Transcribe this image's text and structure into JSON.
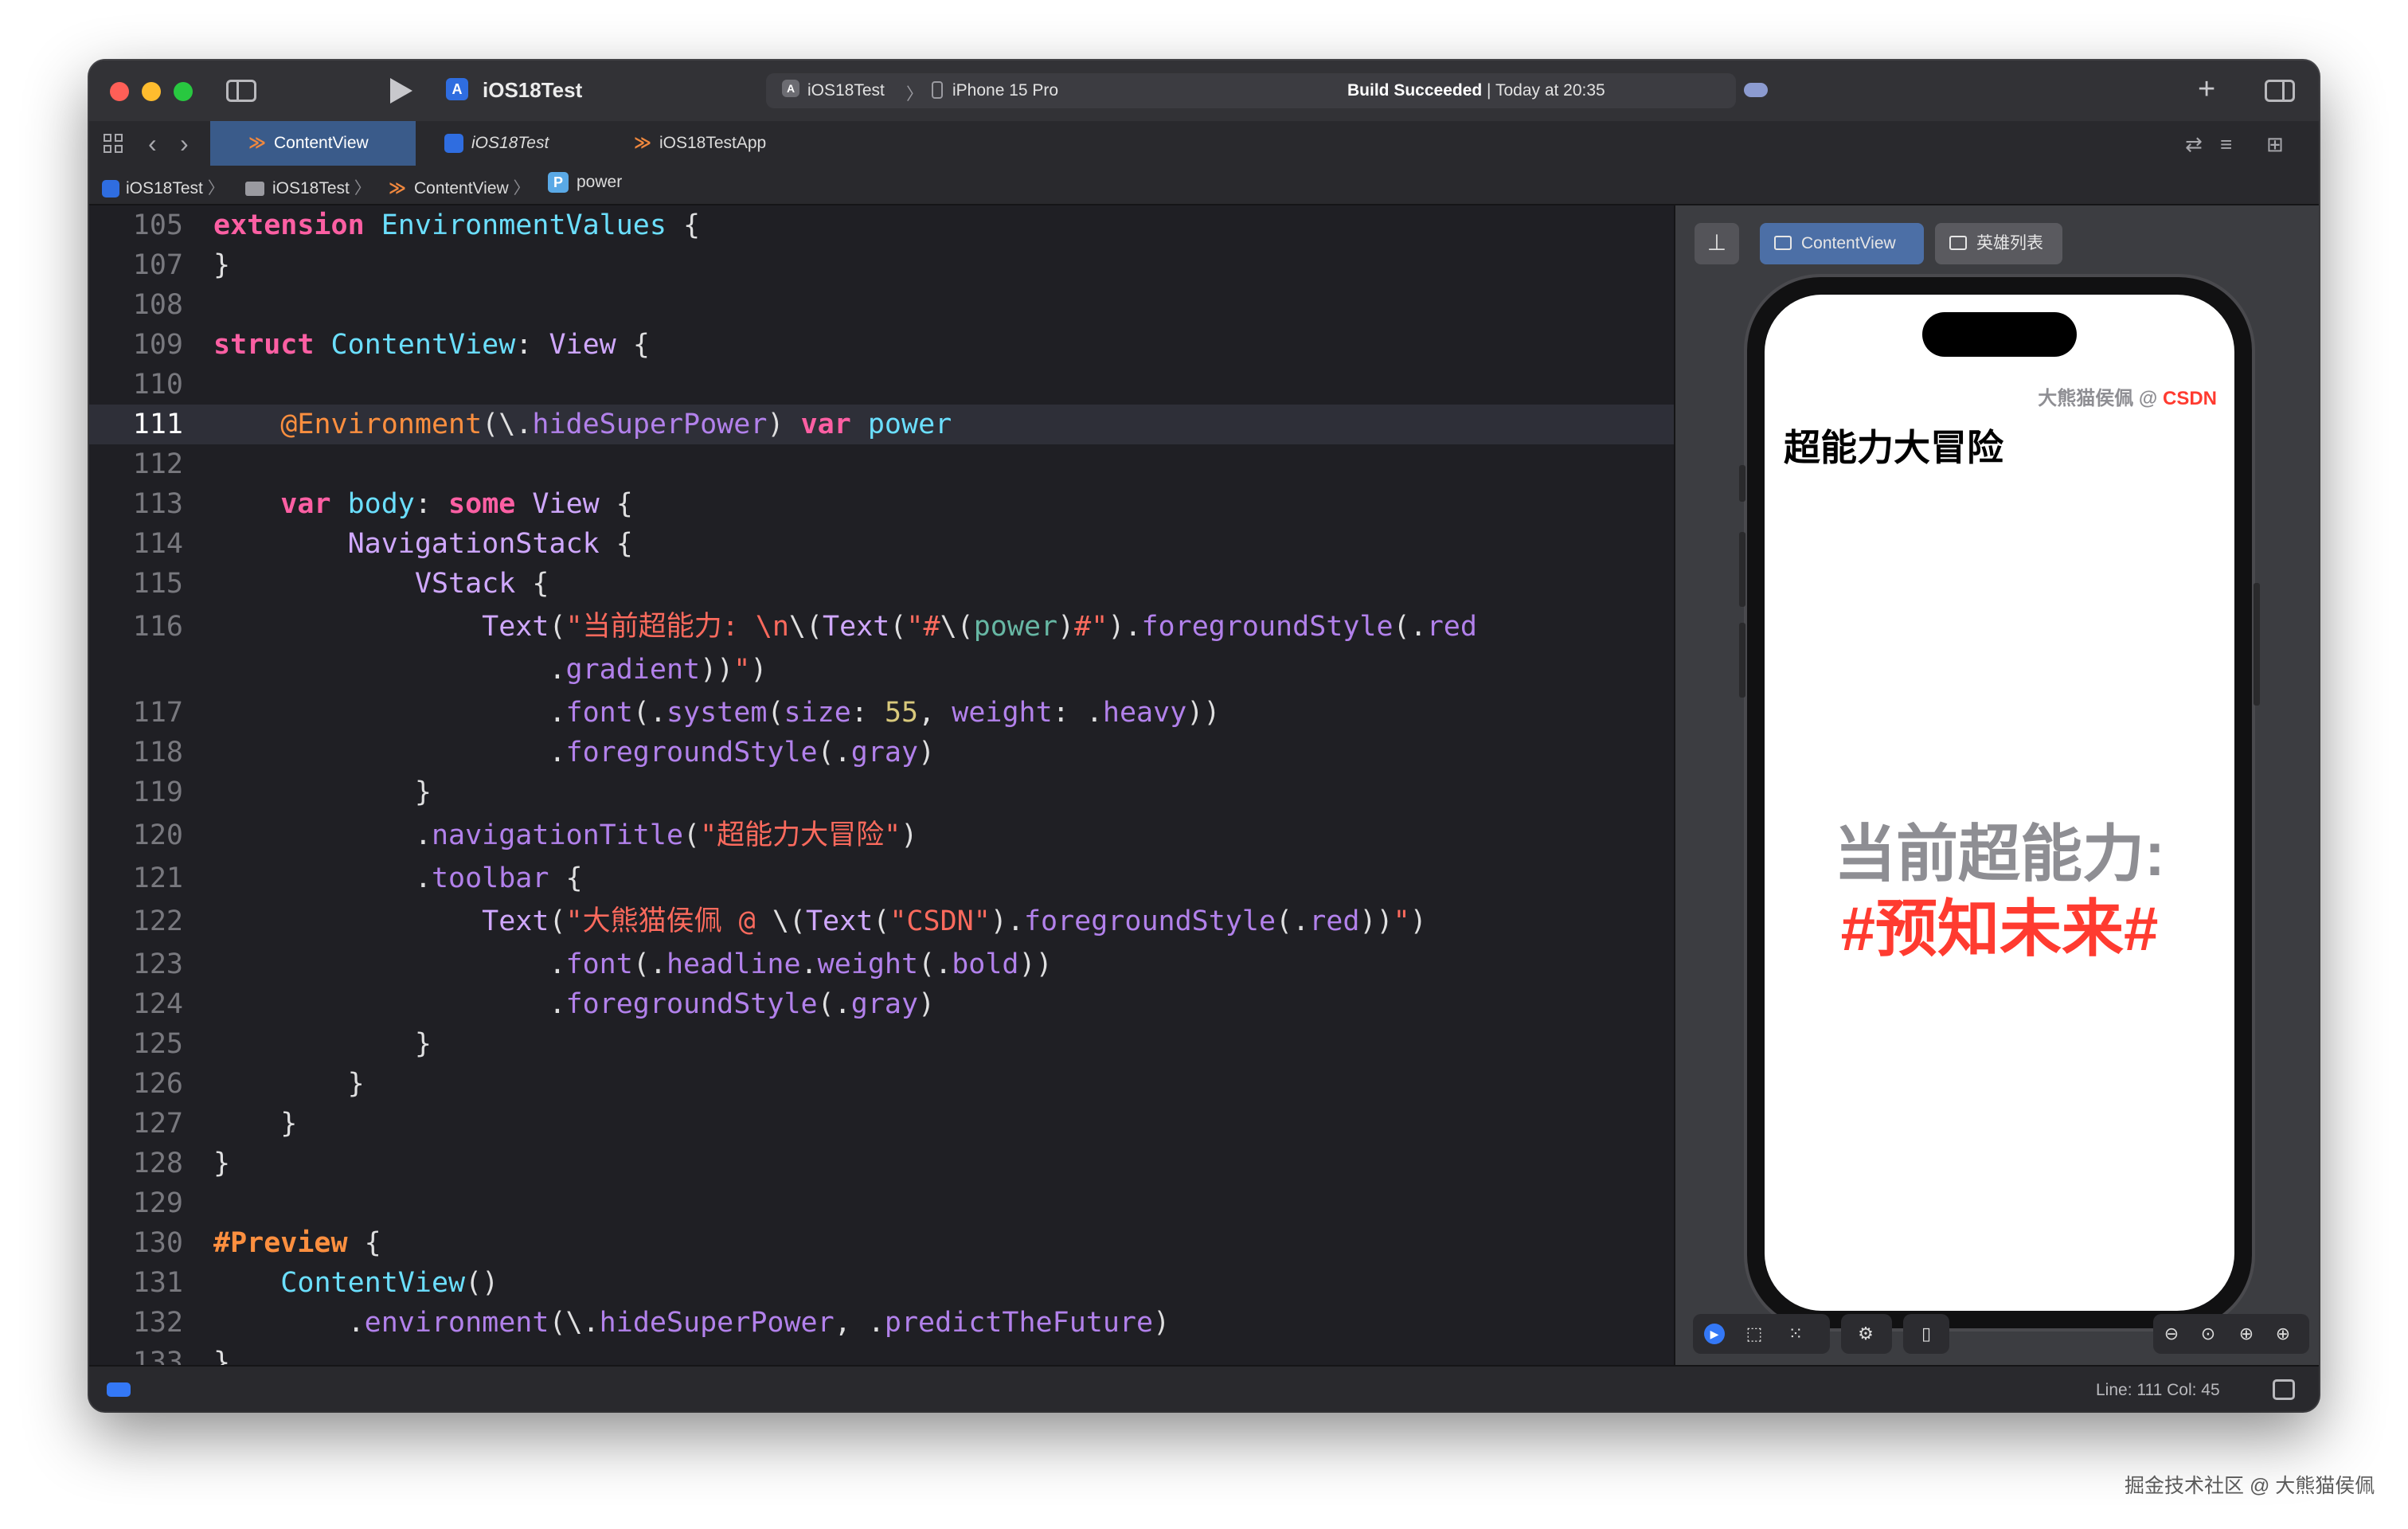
{
  "toolbar": {
    "project_title": "iOS18Test",
    "scheme": "iOS18Test",
    "scheme_chevron": "〉",
    "destination": "iPhone 15 Pro",
    "status_strong": "Build Succeeded",
    "status_rest": " | Today at 20:35"
  },
  "tabs": [
    {
      "label": "ContentView",
      "icon": "swift-icon",
      "active": true
    },
    {
      "label": "iOS18Test",
      "icon": "app-icon",
      "active": false
    },
    {
      "label": "iOS18TestApp",
      "icon": "swift-icon",
      "active": false
    }
  ],
  "jumpbar": [
    "iOS18Test",
    "iOS18Test",
    "ContentView",
    "power"
  ],
  "code_lines": [
    {
      "num": "105",
      "html": "<span class='kw'>extension</span> <span class='ty'>EnvironmentValues</span> {"
    },
    {
      "num": "107",
      "html": "}"
    },
    {
      "num": "108",
      "html": ""
    },
    {
      "num": "109",
      "html": "<span class='kw'>struct</span> <span class='ty'>ContentView</span>: <span class='tyn'>View</span> {"
    },
    {
      "num": "110",
      "html": ""
    },
    {
      "num": "111",
      "html": "    <span class='at'>@Environment</span>(\\.<span class='fn'>hideSuperPower</span>) <span class='kw'>var</span> <span class='ty'>power</span>",
      "current": true
    },
    {
      "num": "112",
      "html": ""
    },
    {
      "num": "113",
      "html": "    <span class='kw'>var</span> <span class='ty'>body</span>: <span class='kw'>some</span> <span class='tyn'>View</span> {"
    },
    {
      "num": "114",
      "html": "        <span class='tyn'>NavigationStack</span> {"
    },
    {
      "num": "115",
      "html": "            <span class='tyn'>VStack</span> {"
    },
    {
      "num": "116",
      "html": "                <span class='tyn'>Text</span>(<span class='st'>\"当前超能力: \\n</span>\\(<span class='tyn'>Text</span>(<span class='st'>\"#</span>\\(<span class='pr'>power</span>)<span class='st'>#\"</span>).<span class='fn'>foregroundStyle</span>(.<span class='fn'>red</span>"
    },
    {
      "num": "",
      "html": "                    .<span class='fn'>gradient</span>))<span class='st'>\"</span>)"
    },
    {
      "num": "117",
      "html": "                    .<span class='fn'>font</span>(.<span class='fn'>system</span>(<span class='fn'>size</span>: <span class='nu'>55</span>, <span class='fn'>weight</span>: .<span class='fn'>heavy</span>))"
    },
    {
      "num": "118",
      "html": "                    .<span class='fn'>foregroundStyle</span>(.<span class='fn'>gray</span>)"
    },
    {
      "num": "119",
      "html": "            }"
    },
    {
      "num": "120",
      "html": "            .<span class='fn'>navigationTitle</span>(<span class='st'>\"超能力大冒险\"</span>)"
    },
    {
      "num": "121",
      "html": "            .<span class='fn'>toolbar</span> {"
    },
    {
      "num": "122",
      "html": "                <span class='tyn'>Text</span>(<span class='st'>\"大熊猫侯佩 @ </span>\\(<span class='tyn'>Text</span>(<span class='st'>\"CSDN\"</span>).<span class='fn'>foregroundStyle</span>(.<span class='fn'>red</span>))<span class='st'>\"</span>)"
    },
    {
      "num": "123",
      "html": "                    .<span class='fn'>font</span>(.<span class='fn'>headline</span>.<span class='fn'>weight</span>(.<span class='fn'>bold</span>))"
    },
    {
      "num": "124",
      "html": "                    .<span class='fn'>foregroundStyle</span>(.<span class='fn'>gray</span>)"
    },
    {
      "num": "125",
      "html": "            }"
    },
    {
      "num": "126",
      "html": "        }"
    },
    {
      "num": "127",
      "html": "    }"
    },
    {
      "num": "128",
      "html": "}"
    },
    {
      "num": "129",
      "html": ""
    },
    {
      "num": "130",
      "html": "<span class='kw' style='color:#fd8f3f'>#Preview</span> {"
    },
    {
      "num": "131",
      "html": "    <span class='ty'>ContentView</span>()"
    },
    {
      "num": "132",
      "html": "        .<span class='fn'>environment</span>(\\.<span class='fn'>hideSuperPower</span>, .<span class='fn'>predictTheFuture</span>)"
    },
    {
      "num": "133",
      "html": "}"
    }
  ],
  "preview": {
    "tab_active": "ContentView",
    "tab_inactive": "英雄列表",
    "toolbar_text_gray": "大熊猫侯佩 @ ",
    "toolbar_text_red": "CSDN",
    "nav_title": "超能力大冒险",
    "power_line1": "当前超能力:",
    "power_line2": "#预知未来#"
  },
  "statusbar": {
    "line_col": "Line: 111  Col: 45"
  },
  "watermark": "掘金技术社区 @ 大熊猫侯佩",
  "colors": {
    "accent": "#3a5b8a",
    "build_status": "#ffffff",
    "preview_red": "#ff3b30",
    "preview_gray": "#8e8e93"
  }
}
